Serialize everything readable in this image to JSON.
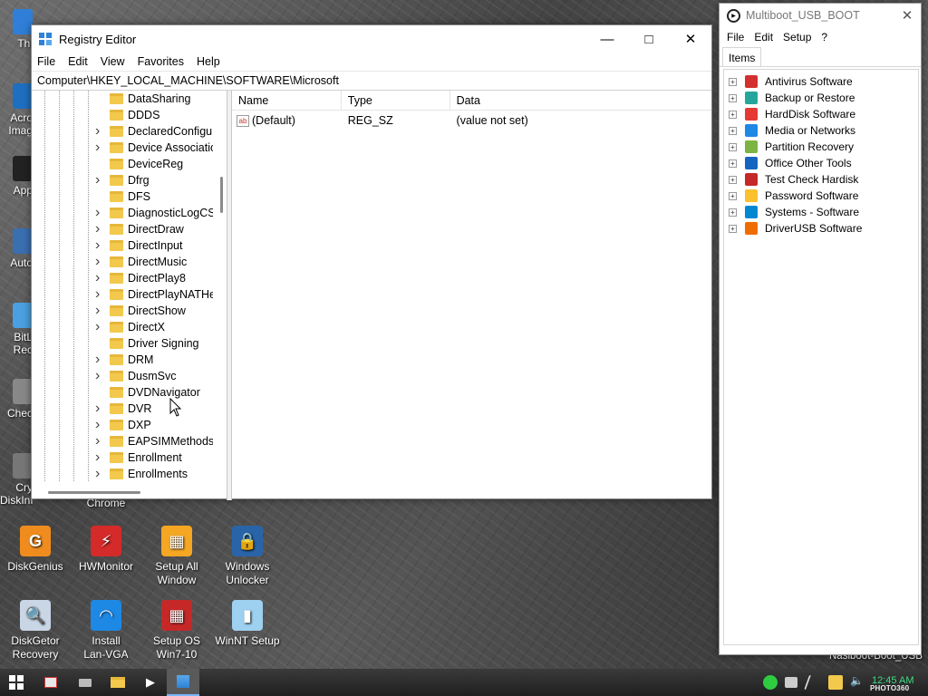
{
  "desktop": {
    "edge_icons": [
      {
        "label": "Thi",
        "color": "#2f7fd8"
      },
      {
        "label": "Acro",
        "label2": "Imag",
        "color": "#1f6fc0"
      },
      {
        "label": "App",
        "color": "#222222"
      },
      {
        "label": "Auto",
        "color": "#3a6fb0"
      },
      {
        "label": "BitL",
        "label2": "Rec",
        "color": "#4aa0e0"
      },
      {
        "label": "Chec",
        "color": "#888888"
      },
      {
        "label": "Cry",
        "label2": "DiskInfo",
        "color": "#777777"
      }
    ],
    "mid_icon": {
      "label": "Chrome"
    },
    "icons": [
      {
        "label": "DiskGenius",
        "glyph": "G",
        "color": "#f08c1e"
      },
      {
        "label": "HWMonitor",
        "glyph": "⚡",
        "color": "#d42a2a"
      },
      {
        "label": "Setup All",
        "label2": "Window",
        "glyph": "▦",
        "color": "#f5a623"
      },
      {
        "label": "Windows",
        "label2": "Unlocker",
        "glyph": "🔒",
        "color": "#2a64a8"
      },
      {
        "label": "DiskGetor",
        "label2": "Recovery",
        "glyph": "🔍",
        "color": "#c8d6e6"
      },
      {
        "label": "Install",
        "label2": "Lan-VGA",
        "glyph": "◠",
        "color": "#1e88e5"
      },
      {
        "label": "Setup OS",
        "label2": "Win7-10",
        "glyph": "▦",
        "color": "#c62828"
      },
      {
        "label": "WinNT Setup",
        "glyph": "▮",
        "color": "#9ed0f0"
      }
    ],
    "corner_label": "Nasiboot-Boot_USB"
  },
  "regedit": {
    "title": "Registry Editor",
    "menu": [
      "File",
      "Edit",
      "View",
      "Favorites",
      "Help"
    ],
    "address": "Computer\\HKEY_LOCAL_MACHINE\\SOFTWARE\\Microsoft",
    "tree": [
      {
        "label": "DataSharing",
        "expandable": false
      },
      {
        "label": "DDDS",
        "expandable": false
      },
      {
        "label": "DeclaredConfigu",
        "expandable": true
      },
      {
        "label": "Device Associatio",
        "expandable": true
      },
      {
        "label": "DeviceReg",
        "expandable": false
      },
      {
        "label": "Dfrg",
        "expandable": true
      },
      {
        "label": "DFS",
        "expandable": false
      },
      {
        "label": "DiagnosticLogCS",
        "expandable": true
      },
      {
        "label": "DirectDraw",
        "expandable": true
      },
      {
        "label": "DirectInput",
        "expandable": true
      },
      {
        "label": "DirectMusic",
        "expandable": true
      },
      {
        "label": "DirectPlay8",
        "expandable": true
      },
      {
        "label": "DirectPlayNATHe",
        "expandable": true
      },
      {
        "label": "DirectShow",
        "expandable": true
      },
      {
        "label": "DirectX",
        "expandable": true
      },
      {
        "label": "Driver Signing",
        "expandable": false
      },
      {
        "label": "DRM",
        "expandable": true
      },
      {
        "label": "DusmSvc",
        "expandable": true
      },
      {
        "label": "DVDNavigator",
        "expandable": false
      },
      {
        "label": "DVR",
        "expandable": true
      },
      {
        "label": "DXP",
        "expandable": true
      },
      {
        "label": "EAPSIMMethods",
        "expandable": true
      },
      {
        "label": "Enrollment",
        "expandable": true
      },
      {
        "label": "Enrollments",
        "expandable": true
      }
    ],
    "columns": [
      "Name",
      "Type",
      "Data"
    ],
    "values": [
      {
        "name": "(Default)",
        "type": "REG_SZ",
        "data": "(value not set)",
        "icon": "ab"
      }
    ]
  },
  "multiboot": {
    "title": "Multiboot_USB_BOOT",
    "menu": [
      "File",
      "Edit",
      "Setup",
      "?"
    ],
    "tab": "Items",
    "items": [
      {
        "label": "Antivirus Software",
        "color": "#d32f2f"
      },
      {
        "label": "Backup or Restore",
        "color": "#26a69a"
      },
      {
        "label": "HardDisk Software",
        "color": "#e53935"
      },
      {
        "label": "Media or Networks",
        "color": "#1e88e5"
      },
      {
        "label": "Partition Recovery",
        "color": "#7cb342"
      },
      {
        "label": "Office Other Tools",
        "color": "#1565c0"
      },
      {
        "label": "Test Check Hardisk",
        "color": "#c62828"
      },
      {
        "label": "Password Software",
        "color": "#fbc02d"
      },
      {
        "label": "Systems - Software",
        "color": "#0288d1"
      },
      {
        "label": "DriverUSB Software",
        "color": "#ef6c00"
      }
    ]
  },
  "taskbar": {
    "clock": "12:45 AM",
    "watermark": "PHOTO360"
  }
}
